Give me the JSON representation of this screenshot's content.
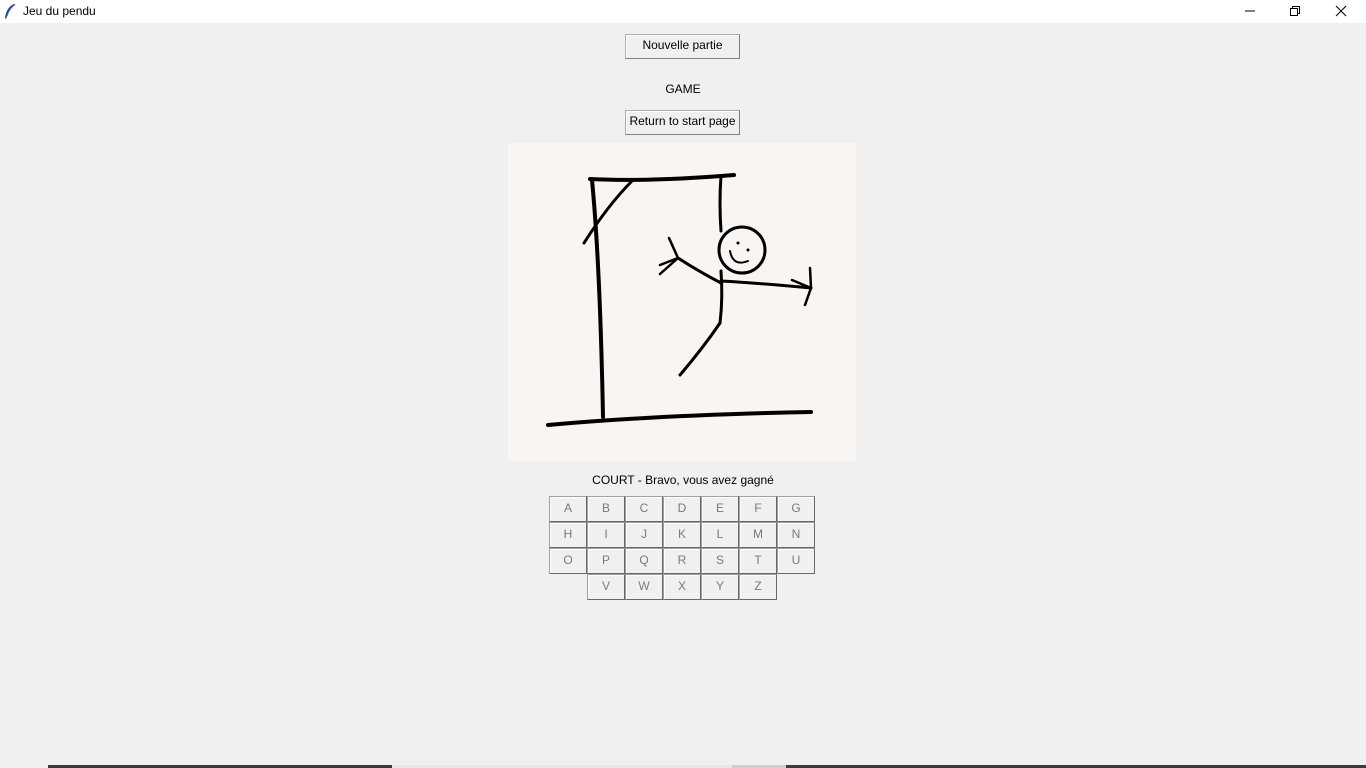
{
  "window": {
    "title": "Jeu du pendu"
  },
  "controls": {
    "minimize_icon": "minimize-icon",
    "maximize_icon": "restore-icon",
    "close_icon": "close-icon"
  },
  "buttons": {
    "new_game": "Nouvelle partie",
    "return_start": "Return to start page"
  },
  "game_label": "GAME",
  "result": "COURT - Bravo, vous avez gagné",
  "keyboard": {
    "keys": [
      "A",
      "B",
      "C",
      "D",
      "E",
      "F",
      "G",
      "H",
      "I",
      "J",
      "K",
      "L",
      "M",
      "N",
      "O",
      "P",
      "Q",
      "R",
      "S",
      "T",
      "U",
      "V",
      "W",
      "X",
      "Y",
      "Z"
    ],
    "state": "disabled"
  },
  "colors": {
    "background": "#f0f0f0",
    "canvas": "#f8f5f2",
    "stroke": "#000000",
    "disabled_text": "#7a7a7a"
  }
}
